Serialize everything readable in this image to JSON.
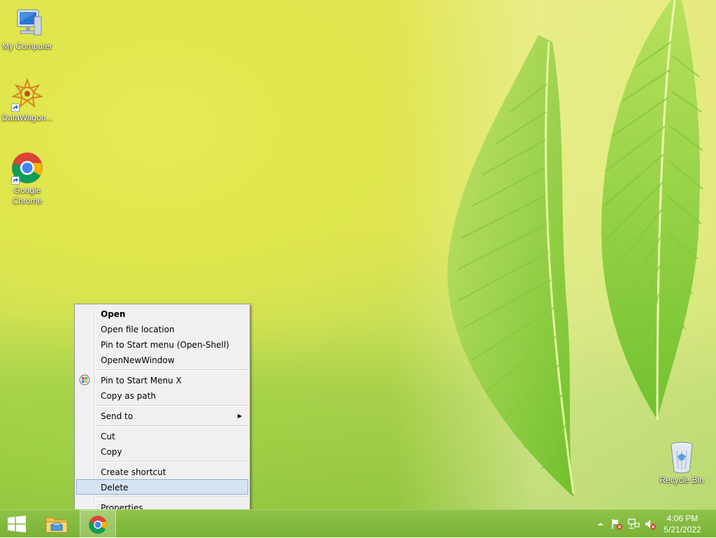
{
  "desktop": {
    "icons": [
      {
        "label": "My Computer"
      },
      {
        "label": "DataWagon..."
      },
      {
        "label": "Google Chrome"
      },
      {
        "label": "Recycle Bin"
      }
    ]
  },
  "context_menu": {
    "items": [
      {
        "label": "Open"
      },
      {
        "label": "Open file location"
      },
      {
        "label": "Pin to Start menu (Open-Shell)"
      },
      {
        "label": "OpenNewWindow"
      },
      {
        "label": "Pin to Start Menu X"
      },
      {
        "label": "Copy as path"
      },
      {
        "label": "Send to"
      },
      {
        "label": "Cut"
      },
      {
        "label": "Copy"
      },
      {
        "label": "Create shortcut"
      },
      {
        "label": "Delete"
      },
      {
        "label": "Properties"
      }
    ],
    "hovered_item": "Delete"
  },
  "taskbar": {
    "pinned": [
      {
        "icon": "windows-logo-icon"
      },
      {
        "icon": "file-explorer-icon"
      },
      {
        "icon": "chrome-icon"
      }
    ],
    "tray": [
      {
        "icon": "show-hidden-icons-icon"
      },
      {
        "icon": "action-center-flag-icon"
      },
      {
        "icon": "network-icon"
      },
      {
        "icon": "volume-muted-icon"
      }
    ],
    "clock": {
      "time": "4:06 PM",
      "date": "5/21/2022"
    }
  },
  "colors": {
    "menu_hover": "#d5e4f3",
    "taskbar": "#84ba3f"
  }
}
